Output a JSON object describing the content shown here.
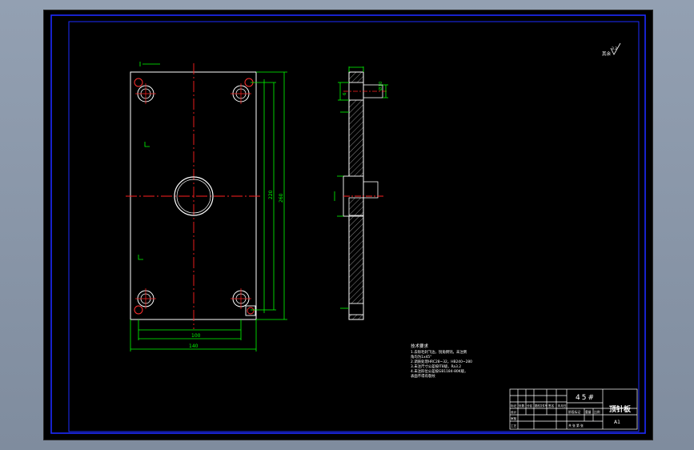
{
  "drawing": {
    "title": "顶针板",
    "material": "45#",
    "scale": "A1",
    "roughness_mark": "其余",
    "notes": {
      "heading": "技术要求",
      "lines": [
        "1.去除毛刺飞边，锐角倒钝，未注倒",
        "  角均为1x45°",
        "2.调质处理HRC28~32，HB240~280",
        "3.未注尺寸公差按IT8级，Ra3.2",
        "4.未注形位公差按GB1184-80K级，",
        "  表面不得有裂纹"
      ]
    },
    "title_block": {
      "row_labels": [
        "标记",
        "处数",
        "分区",
        "更改文件号",
        "签名",
        "年月日"
      ],
      "left_labels": [
        "设计",
        "审核",
        "工艺"
      ],
      "stage_label": "阶段标记",
      "weight_label": "重量",
      "ratio_label": "比例",
      "sheet_label": "共 张  第 张"
    },
    "dimensions": {
      "top_plan": "70",
      "height_overall": "260",
      "height_holes": "220",
      "width_inner": "100",
      "width_overall": "140",
      "section_top": "Ø10",
      "section_side": "6"
    }
  },
  "colors": {
    "outline": "#ffffff",
    "dimension": "#00ff00",
    "centerline": "#ff2020",
    "hatch": "#c8c8c8",
    "frame": "#1d2bff"
  }
}
